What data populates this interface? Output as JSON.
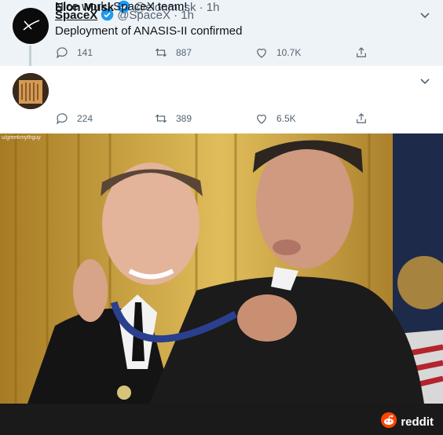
{
  "tweets": [
    {
      "name": "SpaceX",
      "handle": "@SpaceX",
      "time": "· 1h",
      "text": "Deployment of ANASIS-II confirmed",
      "replies": "141",
      "retweets": "887",
      "likes": "10.7K"
    },
    {
      "name": "Elon Musk",
      "handle": "@elonmusk",
      "time": "· 1h",
      "text": "Nice work, SpaceX team!",
      "replies": "224",
      "retweets": "389",
      "likes": "6.5K"
    }
  ],
  "image": {
    "watermark": "u/greekmythguy"
  },
  "footer": {
    "brand": "reddit"
  },
  "colors": {
    "verified": "#1d9bf0",
    "reddit_orange": "#ff4500"
  }
}
